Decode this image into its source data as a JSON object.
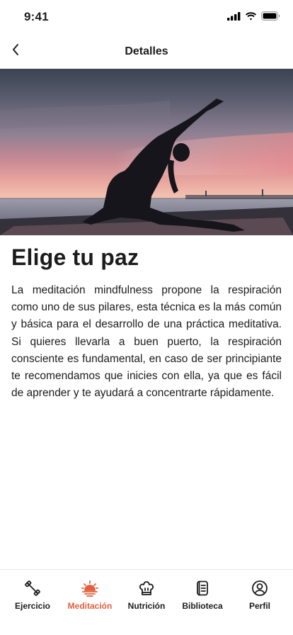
{
  "status_bar": {
    "time": "9:41"
  },
  "nav": {
    "title": "Detalles"
  },
  "article": {
    "title": "Elige tu paz",
    "body": "La meditación mindfulness propone la respiración como uno de sus pilares, esta técnica es la más común y básica para el desarrollo de una práctica meditativa. Si quieres llevarla a buen puerto, la respiración consciente es fundamental, en caso de ser principiante te recomendamos que inicies con ella, ya que es fácil de aprender y te ayudará a concentrarte rápidamente."
  },
  "tabs": [
    {
      "label": "Ejercicio",
      "icon": "dumbbell-icon"
    },
    {
      "label": "Meditación",
      "icon": "sunrise-icon",
      "active": true
    },
    {
      "label": "Nutrición",
      "icon": "chef-hat-icon"
    },
    {
      "label": "Biblioteca",
      "icon": "book-icon"
    },
    {
      "label": "Perfil",
      "icon": "user-icon"
    }
  ],
  "colors": {
    "accent": "#e0603f",
    "text": "#1c1c1c"
  }
}
